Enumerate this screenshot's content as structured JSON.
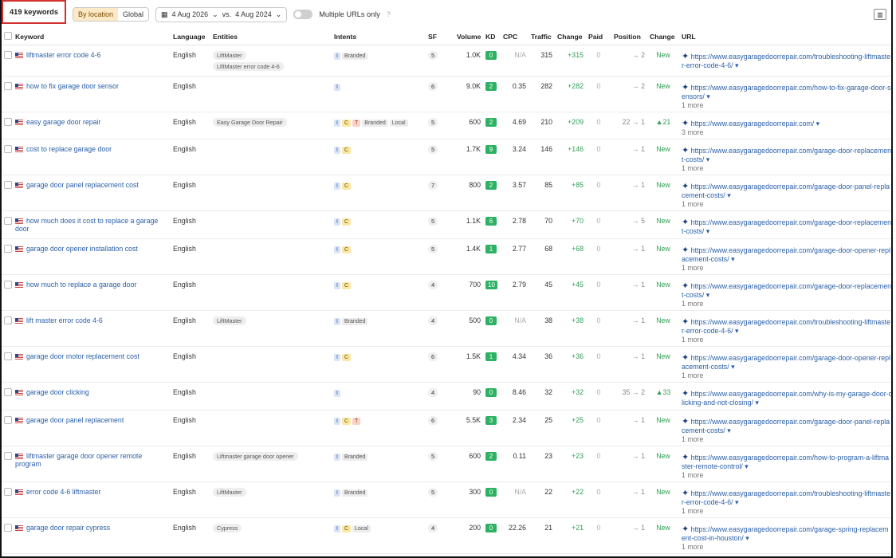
{
  "toolbar": {
    "keyword_count": "419 keywords",
    "seg_by_location": "By location",
    "seg_global": "Global",
    "date_a": "4 Aug 2026",
    "date_vs": "vs.",
    "date_b": "4 Aug 2024",
    "multiple_urls": "Multiple URLs only"
  },
  "table": {
    "headers": [
      "Keyword",
      "Language",
      "Entities",
      "Intents",
      "SF",
      "Volume",
      "KD",
      "CPC",
      "Traffic",
      "Change",
      "Paid",
      "Position",
      "Change",
      "URL"
    ],
    "rows": [
      {
        "keyword": "liftmaster error code 4-6",
        "lang": "English",
        "ent": [
          "LiftMaster",
          "LiftMaster error code 4-6"
        ],
        "intents": [
          "I",
          "Branded"
        ],
        "sf": "5",
        "vol": "1.0K",
        "kd": "0",
        "kd_color": "#2db264",
        "cpc": "N/A",
        "traffic": "315",
        "change": "+315",
        "paid": "0",
        "pos": "→ 2",
        "pos_change": "New",
        "url": "https://www.easygaragedoorrepair.com/troubleshooting-liftmaster-error-code-4-6/ ▾",
        "more": ""
      },
      {
        "keyword": "how to fix garage door sensor",
        "lang": "English",
        "ent": [],
        "intents": [
          "I"
        ],
        "sf": "6",
        "vol": "9.0K",
        "kd": "2",
        "kd_color": "#2db264",
        "cpc": "0.35",
        "traffic": "282",
        "change": "+282",
        "paid": "0",
        "pos": "→ 2",
        "pos_change": "New",
        "url": "https://www.easygaragedoorrepair.com/how-to-fix-garage-door-sensors/ ▾",
        "more": "1 more"
      },
      {
        "keyword": "easy garage door repair",
        "lang": "English",
        "ent": [
          "Easy Garage Door Repair"
        ],
        "intents": [
          "I",
          "C",
          "T",
          "Branded",
          "Local"
        ],
        "sf": "5",
        "vol": "600",
        "kd": "2",
        "kd_color": "#2db264",
        "cpc": "4.69",
        "traffic": "210",
        "change": "+209",
        "paid": "0",
        "pos": "22 → 1",
        "pos_change": "▲21",
        "url": "https://www.easygaragedoorrepair.com/ ▾",
        "more": "3 more"
      },
      {
        "keyword": "cost to replace garage door",
        "lang": "English",
        "ent": [],
        "intents": [
          "I",
          "C"
        ],
        "sf": "5",
        "vol": "1.7K",
        "kd": "9",
        "kd_color": "#2db264",
        "cpc": "3.24",
        "traffic": "146",
        "change": "+146",
        "paid": "0",
        "pos": "→ 1",
        "pos_change": "New",
        "url": "https://www.easygaragedoorrepair.com/garage-door-replacement-costs/ ▾",
        "more": "1 more"
      },
      {
        "keyword": "garage door panel replacement cost",
        "lang": "English",
        "ent": [],
        "intents": [
          "I",
          "C"
        ],
        "sf": "7",
        "vol": "800",
        "kd": "2",
        "kd_color": "#2db264",
        "cpc": "3.57",
        "traffic": "85",
        "change": "+85",
        "paid": "0",
        "pos": "→ 1",
        "pos_change": "New",
        "url": "https://www.easygaragedoorrepair.com/garage-door-panel-replacement-costs/ ▾",
        "more": "1 more"
      },
      {
        "keyword": "how much does it cost to replace a garage door",
        "lang": "English",
        "ent": [],
        "intents": [
          "I",
          "C"
        ],
        "sf": "5",
        "vol": "1.1K",
        "kd": "6",
        "kd_color": "#2db264",
        "cpc": "2.78",
        "traffic": "70",
        "change": "+70",
        "paid": "0",
        "pos": "→ 5",
        "pos_change": "New",
        "url": "https://www.easygaragedoorrepair.com/garage-door-replacement-costs/ ▾",
        "more": ""
      },
      {
        "keyword": "garage door opener installation cost",
        "lang": "English",
        "ent": [],
        "intents": [
          "I",
          "C"
        ],
        "sf": "5",
        "vol": "1.4K",
        "kd": "1",
        "kd_color": "#2db264",
        "cpc": "2.77",
        "traffic": "68",
        "change": "+68",
        "paid": "0",
        "pos": "→ 1",
        "pos_change": "New",
        "url": "https://www.easygaragedoorrepair.com/garage-door-opener-replacement-costs/ ▾",
        "more": "1 more"
      },
      {
        "keyword": "how much to replace a garage door",
        "lang": "English",
        "ent": [],
        "intents": [
          "I",
          "C"
        ],
        "sf": "4",
        "vol": "700",
        "kd": "10",
        "kd_color": "#2db264",
        "cpc": "2.79",
        "traffic": "45",
        "change": "+45",
        "paid": "0",
        "pos": "→ 1",
        "pos_change": "New",
        "url": "https://www.easygaragedoorrepair.com/garage-door-replacement-costs/ ▾",
        "more": "1 more"
      },
      {
        "keyword": "lift master error code 4-6",
        "lang": "English",
        "ent": [
          "LiftMaster"
        ],
        "intents": [
          "I",
          "Branded"
        ],
        "sf": "4",
        "vol": "500",
        "kd": "0",
        "kd_color": "#2db264",
        "cpc": "N/A",
        "traffic": "38",
        "change": "+38",
        "paid": "0",
        "pos": "→ 1",
        "pos_change": "New",
        "url": "https://www.easygaragedoorrepair.com/troubleshooting-liftmaster-error-code-4-6/ ▾",
        "more": "1 more"
      },
      {
        "keyword": "garage door motor replacement cost",
        "lang": "English",
        "ent": [],
        "intents": [
          "I",
          "C"
        ],
        "sf": "6",
        "vol": "1.5K",
        "kd": "1",
        "kd_color": "#2db264",
        "cpc": "4.34",
        "traffic": "36",
        "change": "+36",
        "paid": "0",
        "pos": "→ 1",
        "pos_change": "New",
        "url": "https://www.easygaragedoorrepair.com/garage-door-opener-replacement-costs/ ▾",
        "more": "1 more"
      },
      {
        "keyword": "garage door clicking",
        "lang": "English",
        "ent": [],
        "intents": [
          "I"
        ],
        "sf": "4",
        "vol": "90",
        "kd": "0",
        "kd_color": "#2db264",
        "cpc": "8.46",
        "traffic": "32",
        "change": "+32",
        "paid": "0",
        "pos": "35 → 2",
        "pos_change": "▲33",
        "url": "https://www.easygaragedoorrepair.com/why-is-my-garage-door-clicking-and-not-closing/ ▾",
        "more": ""
      },
      {
        "keyword": "garage door panel replacement",
        "lang": "English",
        "ent": [],
        "intents": [
          "I",
          "C",
          "T"
        ],
        "sf": "6",
        "vol": "5.5K",
        "kd": "3",
        "kd_color": "#2db264",
        "cpc": "2.34",
        "traffic": "25",
        "change": "+25",
        "paid": "0",
        "pos": "→ 1",
        "pos_change": "New",
        "url": "https://www.easygaragedoorrepair.com/garage-door-panel-replacement-costs/ ▾",
        "more": "1 more"
      },
      {
        "keyword": "liftmaster garage door opener remote program",
        "lang": "English",
        "ent": [
          "Liftmaster garage door opener"
        ],
        "intents": [
          "I",
          "Branded"
        ],
        "sf": "5",
        "vol": "600",
        "kd": "2",
        "kd_color": "#2db264",
        "cpc": "0.11",
        "traffic": "23",
        "change": "+23",
        "paid": "0",
        "pos": "→ 1",
        "pos_change": "New",
        "url": "https://www.easygaragedoorrepair.com/how-to-program-a-liftmaster-remote-control/ ▾",
        "more": "1 more"
      },
      {
        "keyword": "error code 4-6 liftmaster",
        "lang": "English",
        "ent": [
          "LiftMaster"
        ],
        "intents": [
          "I",
          "Branded"
        ],
        "sf": "5",
        "vol": "300",
        "kd": "0",
        "kd_color": "#2db264",
        "cpc": "N/A",
        "traffic": "22",
        "change": "+22",
        "paid": "0",
        "pos": "→ 1",
        "pos_change": "New",
        "url": "https://www.easygaragedoorrepair.com/troubleshooting-liftmaster-error-code-4-6/ ▾",
        "more": "1 more"
      },
      {
        "keyword": "garage door repair cypress",
        "lang": "English",
        "ent": [
          "Cypress"
        ],
        "intents": [
          "I",
          "C",
          "Local"
        ],
        "sf": "4",
        "vol": "200",
        "kd": "0",
        "kd_color": "#2db264",
        "cpc": "22.26",
        "traffic": "21",
        "change": "+21",
        "paid": "0",
        "pos": "→ 1",
        "pos_change": "New",
        "url": "https://www.easygaragedoorrepair.com/garage-spring-replacement-cost-in-houston/ ▾",
        "more": "1 more"
      }
    ]
  }
}
